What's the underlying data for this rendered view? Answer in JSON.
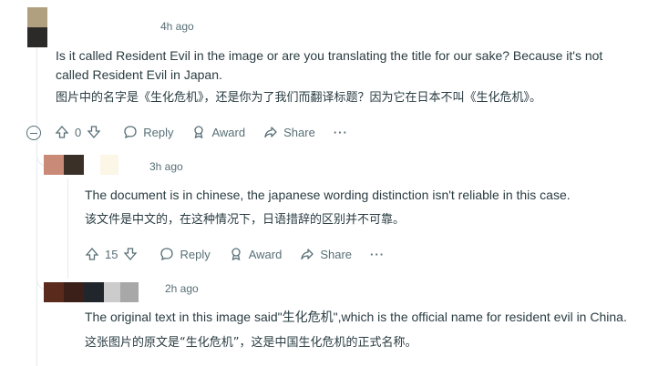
{
  "comments": [
    {
      "time": "4h ago",
      "avatar_colors": [
        "#b0a080",
        "#2c2a28"
      ],
      "text_en": "Is it called Resident Evil in the image or are you translating the title for our sake? Because it's not called Resident Evil in Japan.",
      "text_cn": "图片中的名字是《生化危机》，还是你为了我们而翻译标题？因为它在日本不叫《生化危机》。",
      "votes": "0",
      "actions": {
        "reply": "Reply",
        "award": "Award",
        "share": "Share",
        "more": "···"
      }
    },
    {
      "time": "3h ago",
      "avatar_colors": [
        "#c98a78",
        "#3a3028",
        "#ffffff",
        "#fbf6e6"
      ],
      "text_en": "The document is in chinese, the japanese wording distinction isn't reliable in this case.",
      "text_cn": "该文件是中文的，在这种情况下，日语措辞的区别并不可靠。",
      "votes": "15",
      "actions": {
        "reply": "Reply",
        "award": "Award",
        "share": "Share",
        "more": "···"
      }
    },
    {
      "time": "2h ago",
      "avatar_colors": [
        "#5a2a1c",
        "#3a2018",
        "#20262c",
        "#cccccc",
        "#a8a8a8"
      ],
      "text_en": "The original text in this image said\"生化危机\",which is the official name for resident evil in China.",
      "text_cn": "这张图片的原文是“生化危机”，这是中国生化危机的正式名称。"
    }
  ]
}
